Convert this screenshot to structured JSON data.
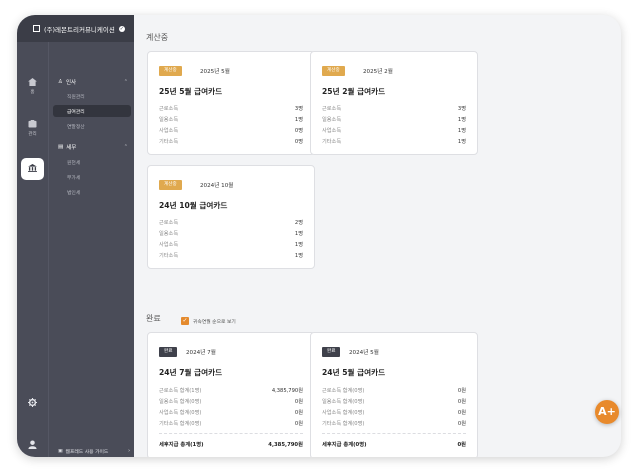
{
  "company": {
    "name": "(주)레몬트리커뮤니케이션"
  },
  "rail": {
    "items": [
      {
        "label": "홈"
      },
      {
        "label": "관리"
      },
      {
        "label": "세무"
      }
    ]
  },
  "sidebar": {
    "group1": {
      "label": "인사",
      "items": [
        "직원관리",
        "급여관리",
        "연말정산"
      ]
    },
    "group2": {
      "label": "세무",
      "items": [
        "원천세",
        "부가세",
        "법인세"
      ]
    },
    "guide": "웹프레드 사용 가이드"
  },
  "sections": {
    "calculating": "계산중",
    "done": "완료",
    "done_filter": "귀속연월 순으로 보기"
  },
  "calc_cards": [
    {
      "badge": "계산중",
      "period": "2025년 5월",
      "title": "25년 5월 급여카드",
      "rows": [
        [
          "근로소득",
          "3명"
        ],
        [
          "일용소득",
          "1명"
        ],
        [
          "사업소득",
          "0명"
        ],
        [
          "기타소득",
          "0명"
        ]
      ]
    },
    {
      "badge": "계산중",
      "period": "2025년 2월",
      "title": "25년 2월 급여카드",
      "rows": [
        [
          "근로소득",
          "3명"
        ],
        [
          "일용소득",
          "1명"
        ],
        [
          "사업소득",
          "1명"
        ],
        [
          "기타소득",
          "1명"
        ]
      ]
    },
    {
      "badge": "계산중",
      "period": "2024년 10월",
      "title": "24년 10월 급여카드",
      "rows": [
        [
          "근로소득",
          "2명"
        ],
        [
          "일용소득",
          "1명"
        ],
        [
          "사업소득",
          "1명"
        ],
        [
          "기타소득",
          "1명"
        ]
      ]
    }
  ],
  "done_cards": [
    {
      "badge": "완료",
      "period": "2024년 7월",
      "title": "24년 7월 급여카드",
      "rows": [
        [
          "근로소득 합계(1명)",
          "4,385,790원"
        ],
        [
          "일용소득 합계(0명)",
          "0원"
        ],
        [
          "사업소득 합계(0명)",
          "0원"
        ],
        [
          "기타소득 합계(0명)",
          "0원"
        ]
      ],
      "total": [
        "세후지급 총계(1명)",
        "4,385,790원"
      ]
    },
    {
      "badge": "완료",
      "period": "2024년 5월",
      "title": "24년 5월 급여카드",
      "rows": [
        [
          "근로소득 합계(0명)",
          "0원"
        ],
        [
          "일용소득 합계(0명)",
          "0원"
        ],
        [
          "사업소득 합계(0명)",
          "0원"
        ],
        [
          "기타소득 합계(0명)",
          "0원"
        ]
      ],
      "total": [
        "세후지급 총계(0명)",
        "0원"
      ]
    }
  ],
  "colors": {
    "accent": "#e88a2c",
    "calc_badge": "#e0a94e",
    "done_badge": "#3f414b",
    "sidebar": "#4a4c58"
  },
  "fab": {
    "icon": "a-plus-icon",
    "label": "A+"
  }
}
